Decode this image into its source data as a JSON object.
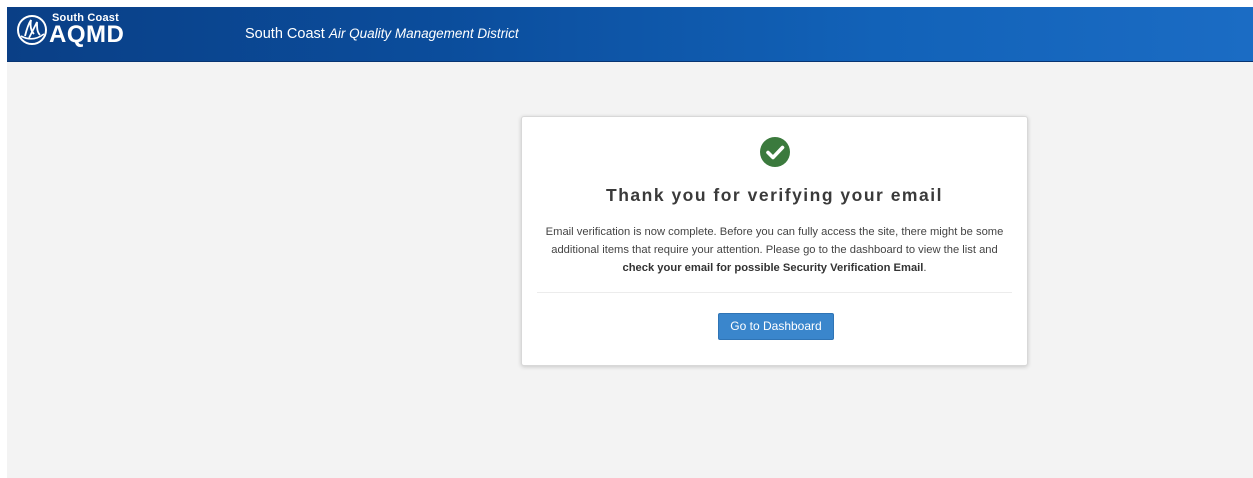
{
  "header": {
    "logo_top": "South Coast",
    "logo_main": "AQMD",
    "title_plain": "South Coast",
    "title_italic": "Air Quality Management District"
  },
  "card": {
    "icon": "check-circle-icon",
    "title": "Thank you for verifying your email",
    "body_text": "Email verification is now complete. Before you can fully access the site, there might be some additional items that require your attention. Please go to the dashboard to view the list and ",
    "body_bold": "check your email for possible Security Verification Email",
    "body_end": ".",
    "button_label": "Go to Dashboard"
  },
  "colors": {
    "header_blue": "#0b4d9c",
    "success_green": "#3b7a3d",
    "button_blue": "#3a86cc"
  }
}
